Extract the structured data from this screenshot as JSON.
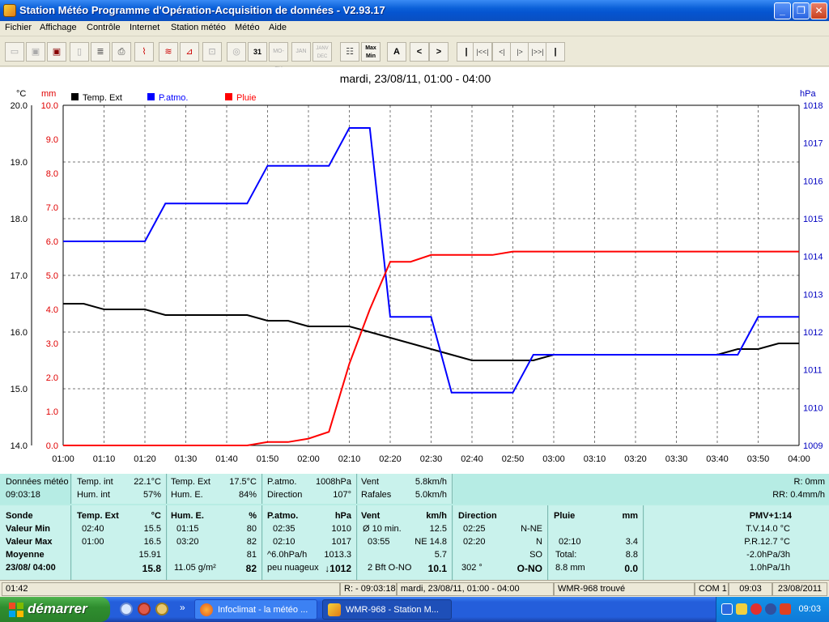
{
  "window": {
    "title": "Station Météo Programme d'Opération-Acquisition de données - V2.93.17"
  },
  "menu": [
    "Fichier",
    "Affichage",
    "Contrôle",
    "Internet",
    "Station météo",
    "Météo",
    "Aide"
  ],
  "toolbar": {
    "btn_31": "31",
    "btn_mo_su": "MO-SU",
    "btn_jan": "JAN",
    "btn_janv_dec": "JANV DEC",
    "btn_min_max": "Max Min",
    "btn_a": "A",
    "btn_prev": "<",
    "btn_next": ">",
    "btn_first": "|",
    "btn_rew": "|<<|",
    "btn_back": "<|",
    "btn_fwd": "|>",
    "btn_ffwd": "|>>|",
    "btn_last": "|"
  },
  "chart_data": {
    "type": "line",
    "title": "mardi, 23/08/11, 01:00 - 04:00",
    "x": [
      "01:00",
      "01:05",
      "01:10",
      "01:15",
      "01:20",
      "01:25",
      "01:30",
      "01:35",
      "01:40",
      "01:45",
      "01:50",
      "01:55",
      "02:00",
      "02:05",
      "02:10",
      "02:15",
      "02:20",
      "02:25",
      "02:30",
      "02:35",
      "02:40",
      "02:45",
      "02:50",
      "02:55",
      "03:00",
      "03:05",
      "03:10",
      "03:15",
      "03:20",
      "03:25",
      "03:30",
      "03:35",
      "03:40",
      "03:45",
      "03:50",
      "03:55",
      "04:00"
    ],
    "xticks": [
      "01:00",
      "01:10",
      "01:20",
      "01:30",
      "01:40",
      "01:50",
      "02:00",
      "02:10",
      "02:20",
      "02:30",
      "02:40",
      "02:50",
      "03:00",
      "03:10",
      "03:20",
      "03:30",
      "03:40",
      "03:50",
      "04:00"
    ],
    "axes": {
      "left_temp": {
        "unit": "°C",
        "range": [
          14.0,
          20.0
        ],
        "ticks": [
          "14.0",
          "15.0",
          "16.0",
          "17.0",
          "18.0",
          "19.0",
          "20.0"
        ]
      },
      "left_rain": {
        "unit": "mm",
        "range": [
          0.0,
          10.0
        ],
        "ticks": [
          "0.0",
          "1.0",
          "2.0",
          "3.0",
          "4.0",
          "5.0",
          "6.0",
          "7.0",
          "8.0",
          "9.0",
          "10.0"
        ]
      },
      "right_pressure": {
        "unit": "hPa",
        "range": [
          1009,
          1018
        ],
        "ticks": [
          "1009",
          "1010",
          "1011",
          "1012",
          "1013",
          "1014",
          "1015",
          "1016",
          "1017",
          "1018"
        ]
      }
    },
    "grid": true,
    "series": [
      {
        "name": "Temp. Ext",
        "axis": "left_temp",
        "color": "#000000",
        "values": [
          16.5,
          16.5,
          16.4,
          16.4,
          16.4,
          16.3,
          16.3,
          16.3,
          16.3,
          16.3,
          16.2,
          16.2,
          16.1,
          16.1,
          16.1,
          16.0,
          15.9,
          15.8,
          15.7,
          15.6,
          15.5,
          15.5,
          15.5,
          15.5,
          15.6,
          15.6,
          15.6,
          15.6,
          15.6,
          15.6,
          15.6,
          15.6,
          15.6,
          15.7,
          15.7,
          15.8,
          15.8
        ]
      },
      {
        "name": "P.atmo.",
        "axis": "right_pressure",
        "color": "#0000ff",
        "values": [
          1014.4,
          1014.4,
          1014.4,
          1014.4,
          1014.4,
          1015.4,
          1015.4,
          1015.4,
          1015.4,
          1015.4,
          1016.4,
          1016.4,
          1016.4,
          1016.4,
          1017.4,
          1017.4,
          1012.4,
          1012.4,
          1012.4,
          1010.4,
          1010.4,
          1010.4,
          1010.4,
          1011.4,
          1011.4,
          1011.4,
          1011.4,
          1011.4,
          1011.4,
          1011.4,
          1011.4,
          1011.4,
          1011.4,
          1011.4,
          1012.4,
          1012.4,
          1012.4
        ]
      },
      {
        "name": "Pluie",
        "axis": "left_rain",
        "color": "#ff0000",
        "values": [
          0,
          0,
          0,
          0,
          0,
          0,
          0,
          0,
          0,
          0,
          0.1,
          0.1,
          0.2,
          0.4,
          2.4,
          4.0,
          5.4,
          5.4,
          5.6,
          5.6,
          5.6,
          5.6,
          5.7,
          5.7,
          5.7,
          5.7,
          5.7,
          5.7,
          5.7,
          5.7,
          5.7,
          5.7,
          5.7,
          5.7,
          5.7,
          5.7,
          5.7
        ]
      }
    ]
  },
  "row1": {
    "donnees_label": "Données météo",
    "donnees_time": "09:03:18",
    "temp_int_label": "Temp. int",
    "temp_int": "22.1°C",
    "hum_int_label": "Hum. int",
    "hum_int": "57%",
    "temp_ext_label": "Temp. Ext",
    "temp_ext": "17.5°C",
    "hum_e_label": "Hum. E.",
    "hum_e": "84%",
    "patmo_label": "P.atmo.",
    "patmo": "1008hPa",
    "direction_label": "Direction",
    "direction": "107°",
    "vent_label": "Vent",
    "vent": "5.8km/h",
    "rafales_label": "Rafales",
    "rafales": "5.0km/h",
    "r_rain": "R: 0mm",
    "rr_rain": "RR: 0.4mm/h"
  },
  "table": {
    "sonde": {
      "h": "Sonde",
      "min": "Valeur Min",
      "max": "Valeur Max",
      "moy": "Moyenne",
      "now": "23/08/ 04:00"
    },
    "temp": {
      "h": "Temp. Ext",
      "u": "°C",
      "min_t": "02:40",
      "min_v": "15.5",
      "max_t": "01:00",
      "max_v": "16.5",
      "moy": "15.91",
      "now": "15.8"
    },
    "hum": {
      "h": "Hum. E.",
      "u": "%",
      "min_t": "01:15",
      "min_v": "80",
      "max_t": "03:20",
      "max_v": "82",
      "moy": "81",
      "now_l": "11.05 g/m²",
      "now": "82"
    },
    "patmo": {
      "h": "P.atmo.",
      "u": "hPa",
      "min_t": "02:35",
      "min_v": "1010",
      "max_t": "02:10",
      "max_v": "1017",
      "moy_l": "^6.0hPa/h",
      "moy": "1013.3",
      "now_l": "peu nuageux",
      "now": "↓1012"
    },
    "vent": {
      "h": "Vent",
      "u": "km/h",
      "min_t": "Ø 10 min.",
      "min_v": "12.5",
      "max_t": "03:55",
      "max_v": "NE 14.8",
      "moy": "5.7",
      "now_l": "2 Bft O-NO",
      "now": "10.1"
    },
    "dir": {
      "h": "Direction",
      "min_t": "02:25",
      "min_v": "N-NE",
      "max_t": "02:20",
      "max_v": "N",
      "moy": "SO",
      "now_l": "302 °",
      "now": "O-NO"
    },
    "pluie": {
      "h": "Pluie",
      "u": "mm",
      "max_t": "02:10",
      "max_v": "3.4",
      "moy_l": "Total:",
      "moy": "8.8",
      "now_l": "8.8 mm",
      "now": "0.0"
    },
    "pmv": {
      "h": "PMV+1:14",
      "l1": "T.V.14.0 °C",
      "l2": "P.R.12.7 °C",
      "l3": "-2.0hPa/3h",
      "l4": "1.0hPa/1h"
    }
  },
  "status": {
    "time": "01:42",
    "range": "R: - 09:03:18",
    "period": "mardi, 23/08/11, 01:00 - 04:00",
    "station": "WMR-968  trouvé",
    "port": "COM 1",
    "clock": "09:03",
    "date": "23/08/2011"
  },
  "taskbar": {
    "start": "démarrer",
    "chevron": "»",
    "task1": "Infoclimat - la météo ...",
    "task2": "WMR-968 - Station M...",
    "clock": "09:03"
  }
}
